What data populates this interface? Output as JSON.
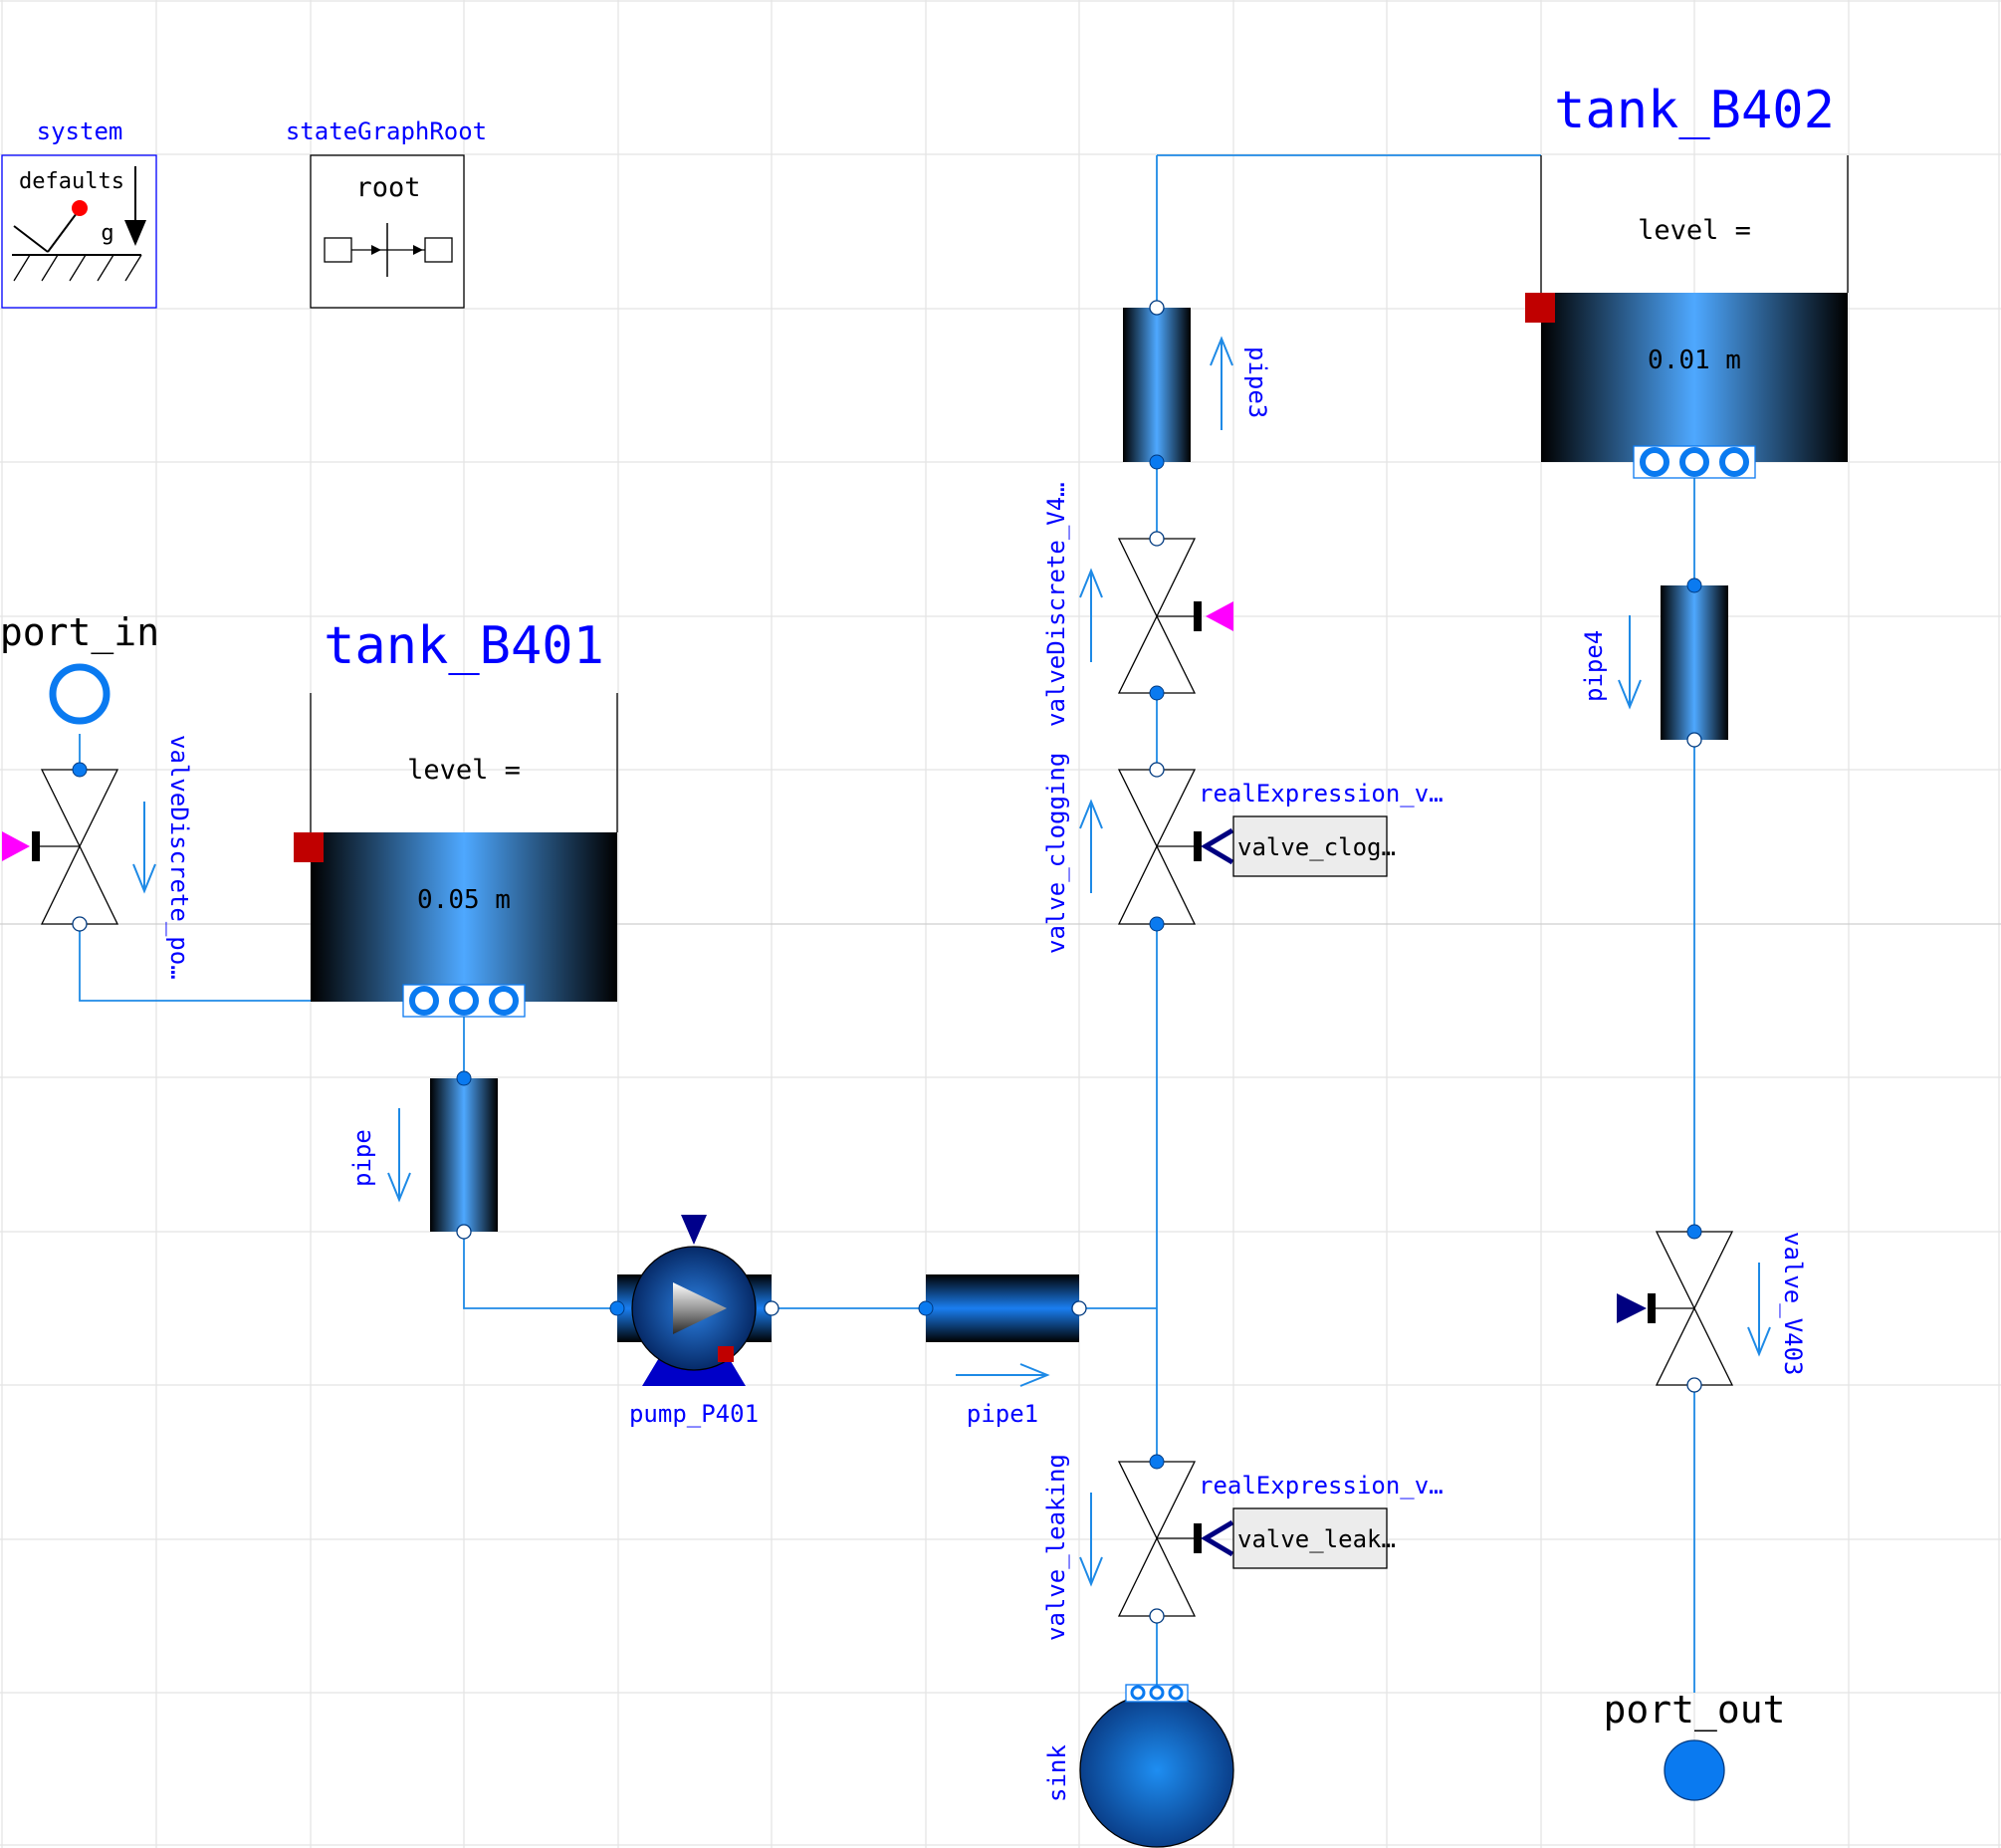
{
  "system": {
    "label": "system",
    "inner_label": "defaults",
    "g_label": "g"
  },
  "state_graph_root": {
    "label": "stateGraphRoot",
    "inner_label": "root"
  },
  "port_in": {
    "label": "port_in"
  },
  "port_out": {
    "label": "port_out"
  },
  "tank_B401": {
    "label": "tank_B401",
    "level_label": "level =",
    "level_value": "0.05 m"
  },
  "tank_B402": {
    "label": "tank_B402",
    "level_label": "level =",
    "level_value": "0.01 m"
  },
  "valve_discrete_port": {
    "label": "valveDiscrete_po…"
  },
  "valve_discrete_v4": {
    "label": "valveDiscrete_V4…"
  },
  "valve_clogging": {
    "label": "valve_clogging"
  },
  "valve_leaking": {
    "label": "valve_leaking"
  },
  "valve_V403": {
    "label": "valve_V403"
  },
  "real_expr_clogging": {
    "label": "realExpression_v…",
    "value": "valve_clog…"
  },
  "real_expr_leaking": {
    "label": "realExpression_v…",
    "value": "valve_leak…"
  },
  "pipe": {
    "label": "pipe"
  },
  "pipe1": {
    "label": "pipe1"
  },
  "pipe3": {
    "label": "pipe3"
  },
  "pipe4": {
    "label": "pipe4"
  },
  "pump_P401": {
    "label": "pump_P401"
  },
  "sink": {
    "label": "sink"
  },
  "colors": {
    "connection": "#1e8ae6",
    "label": "#0000ff",
    "port_fill": "#0a7af0",
    "boolean_input": "#ff00ff",
    "real_input": "#000080",
    "heat_port": "#c00000"
  }
}
